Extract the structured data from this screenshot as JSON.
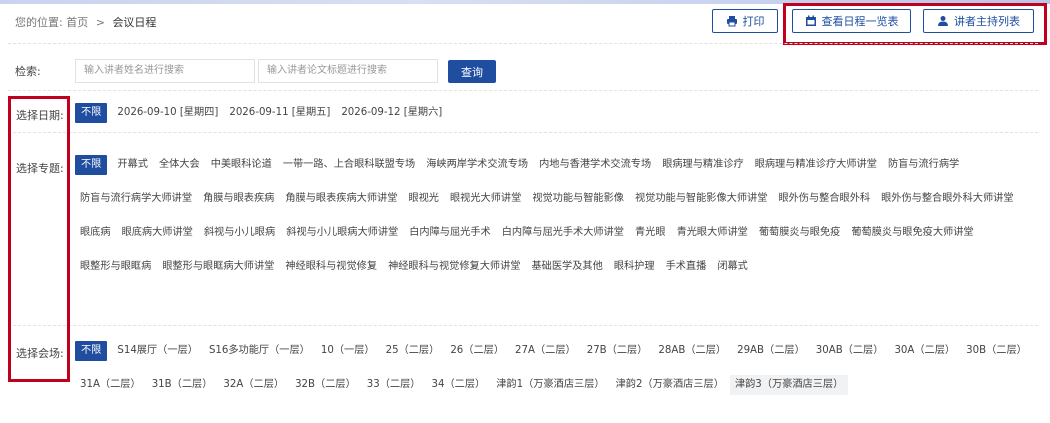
{
  "breadcrumb": {
    "prefix": "您的位置:",
    "home": "首页",
    "separator": ">",
    "current": "会议日程"
  },
  "toolbar": {
    "print": "打印",
    "schedule_overview": "查看日程一览表",
    "speaker_list": "讲者主持列表"
  },
  "search": {
    "label": "检索:",
    "name_placeholder": "输入讲者姓名进行搜索",
    "title_placeholder": "输入讲者论文标题进行搜索",
    "submit": "查询"
  },
  "filters": {
    "date": {
      "label": "选择日期:",
      "options": [
        "不限",
        "2026-09-10 [星期四]",
        "2026-09-11 [星期五]",
        "2026-09-12 [星期六]"
      ]
    },
    "topic": {
      "label": "选择专题:",
      "options": [
        "不限",
        "开幕式",
        "全体大会",
        "中美眼科论道",
        "一带一路、上合眼科联盟专场",
        "海峡两岸学术交流专场",
        "内地与香港学术交流专场",
        "眼病理与精准诊疗",
        "眼病理与精准诊疗大师讲堂",
        "防盲与流行病学",
        "防盲与流行病学大师讲堂",
        "角膜与眼表疾病",
        "角膜与眼表疾病大师讲堂",
        "眼视光",
        "眼视光大师讲堂",
        "视觉功能与智能影像",
        "视觉功能与智能影像大师讲堂",
        "眼外伤与整合眼外科",
        "眼外伤与整合眼外科大师讲堂",
        "眼底病",
        "眼底病大师讲堂",
        "斜视与小儿眼病",
        "斜视与小儿眼病大师讲堂",
        "白内障与屈光手术",
        "白内障与屈光手术大师讲堂",
        "青光眼",
        "青光眼大师讲堂",
        "葡萄膜炎与眼免疫",
        "葡萄膜炎与眼免疫大师讲堂",
        "眼整形与眼眶病",
        "眼整形与眼眶病大师讲堂",
        "神经眼科与视觉修复",
        "神经眼科与视觉修复大师讲堂",
        "基础医学及其他",
        "眼科护理",
        "手术直播",
        "闭幕式"
      ]
    },
    "venue": {
      "label": "选择会场:",
      "options": [
        "不限",
        "S14展厅（一层）",
        "S16多功能厅（一层）",
        "10（一层）",
        "25（二层）",
        "26（二层）",
        "27A（二层）",
        "27B（二层）",
        "28AB（二层）",
        "29AB（二层）",
        "30AB（二层）",
        "30A（二层）",
        "30B（二层）",
        "31A（二层）",
        "31B（二层）",
        "32A（二层）",
        "32B（二层）",
        "33（二层）",
        "34（二层）",
        "津韵1（万豪酒店三层）",
        "津韵2（万豪酒店三层）",
        "津韵3（万豪酒店三层）"
      ]
    }
  },
  "colors": {
    "accent": "#1f4ea1",
    "highlight_box": "#c0001d"
  }
}
